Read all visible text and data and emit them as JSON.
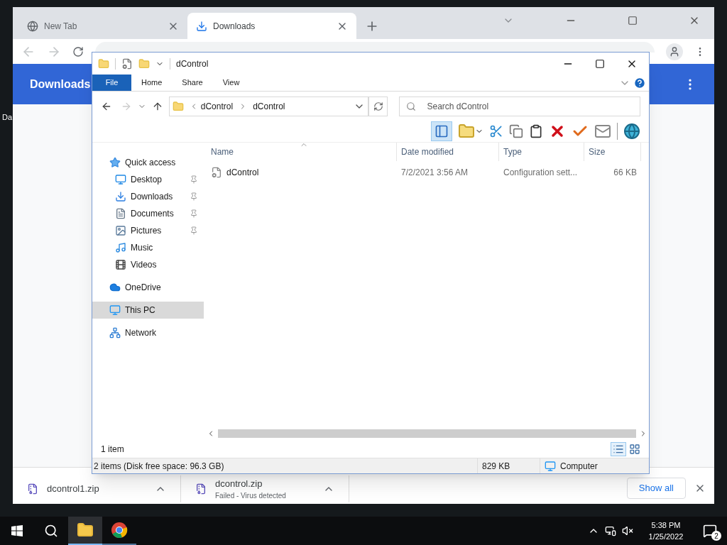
{
  "desktop": {
    "icon_label": "Da"
  },
  "browser": {
    "tabs": [
      {
        "title": "New Tab",
        "selected": false,
        "kind": "newtab"
      },
      {
        "title": "Downloads",
        "selected": true,
        "kind": "downloads"
      }
    ],
    "page_title": "Downloads",
    "shelf": {
      "items": [
        {
          "name": "dcontrol1.zip"
        },
        {
          "name": "dcontrol.zip",
          "status": "Failed - Virus detected"
        }
      ],
      "show_all": "Show all"
    }
  },
  "explorer": {
    "title": "dControl",
    "ribbon_tabs": [
      {
        "label": "File",
        "kind": "file",
        "selected": false
      },
      {
        "label": "Home",
        "kind": "tab",
        "selected": false
      },
      {
        "label": "Share",
        "kind": "tab",
        "selected": false
      },
      {
        "label": "View",
        "kind": "tab",
        "selected": false
      }
    ],
    "breadcrumb": [
      "dControl",
      "dControl"
    ],
    "search": {
      "placeholder": "Search dControl"
    },
    "nav": [
      {
        "label": "Quick access",
        "kind": "star",
        "selected": false,
        "children": [
          {
            "label": "Desktop",
            "kind": "desktop",
            "pinned": true,
            "selected": false
          },
          {
            "label": "Downloads",
            "kind": "download",
            "pinned": true,
            "selected": false
          },
          {
            "label": "Documents",
            "kind": "document",
            "pinned": true,
            "selected": false
          },
          {
            "label": "Pictures",
            "kind": "picture",
            "pinned": true,
            "selected": false
          },
          {
            "label": "Music",
            "kind": "music",
            "pinned": false,
            "selected": false
          },
          {
            "label": "Videos",
            "kind": "video",
            "pinned": false,
            "selected": false
          }
        ]
      },
      {
        "label": "OneDrive",
        "kind": "cloud",
        "selected": false
      },
      {
        "label": "This PC",
        "kind": "pc",
        "selected": true
      },
      {
        "label": "Network",
        "kind": "network",
        "selected": false
      }
    ],
    "columns": [
      "Name",
      "Date modified",
      "Type",
      "Size"
    ],
    "rows": [
      {
        "name": "dControl",
        "date": "7/2/2021 3:56 AM",
        "type": "Configuration sett...",
        "size": "66 KB"
      }
    ],
    "item_count": "1 item",
    "status": {
      "items": "2 items (Disk free space: 96.3 GB)",
      "size": "829 KB",
      "location": "Computer"
    }
  },
  "taskbar": {
    "apps": [
      {
        "kind": "explorer",
        "selected": true
      },
      {
        "kind": "chrome",
        "selected": false
      }
    ],
    "time": "5:38 PM",
    "date": "1/25/2022",
    "notifications": "2"
  }
}
